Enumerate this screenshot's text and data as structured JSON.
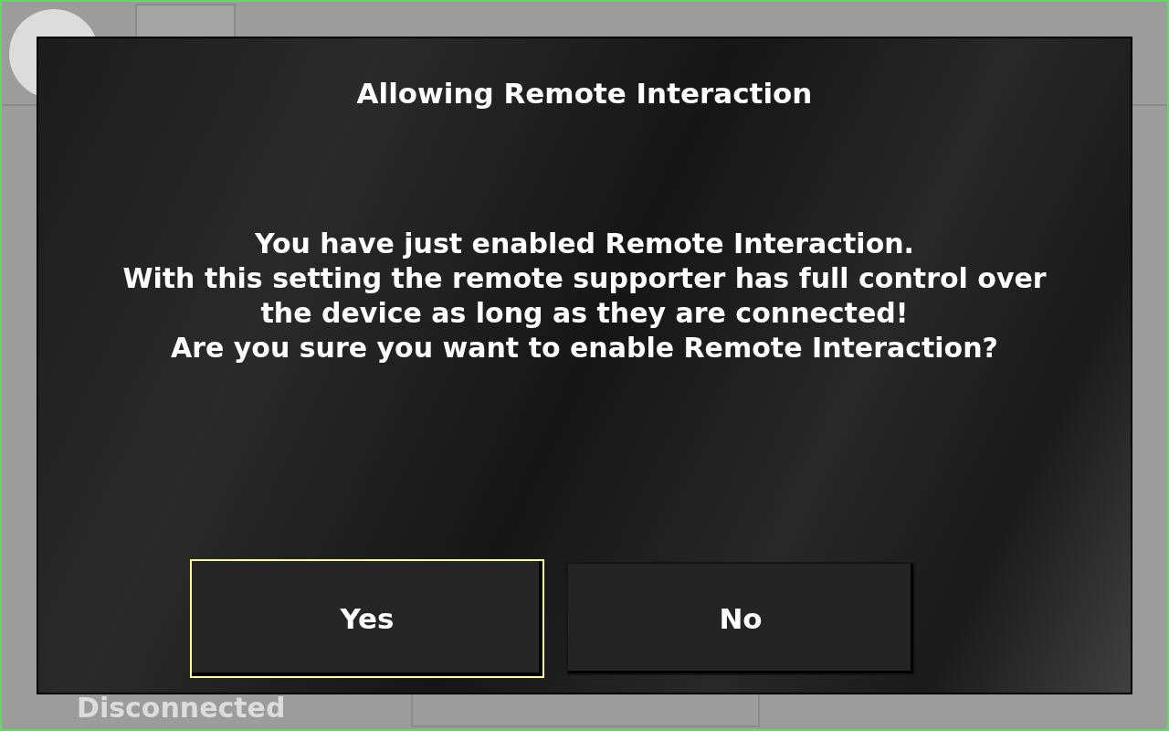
{
  "background": {
    "status": "Disconnected"
  },
  "dialog": {
    "title": "Allowing Remote Interaction",
    "message": "You have just enabled Remote Interaction.\nWith this setting the remote supporter has full control over\nthe device as long as they are connected!\nAre you sure you want to enable Remote Interaction?",
    "buttons": [
      {
        "label": "Yes",
        "selected": true
      },
      {
        "label": "No",
        "selected": false
      }
    ]
  }
}
